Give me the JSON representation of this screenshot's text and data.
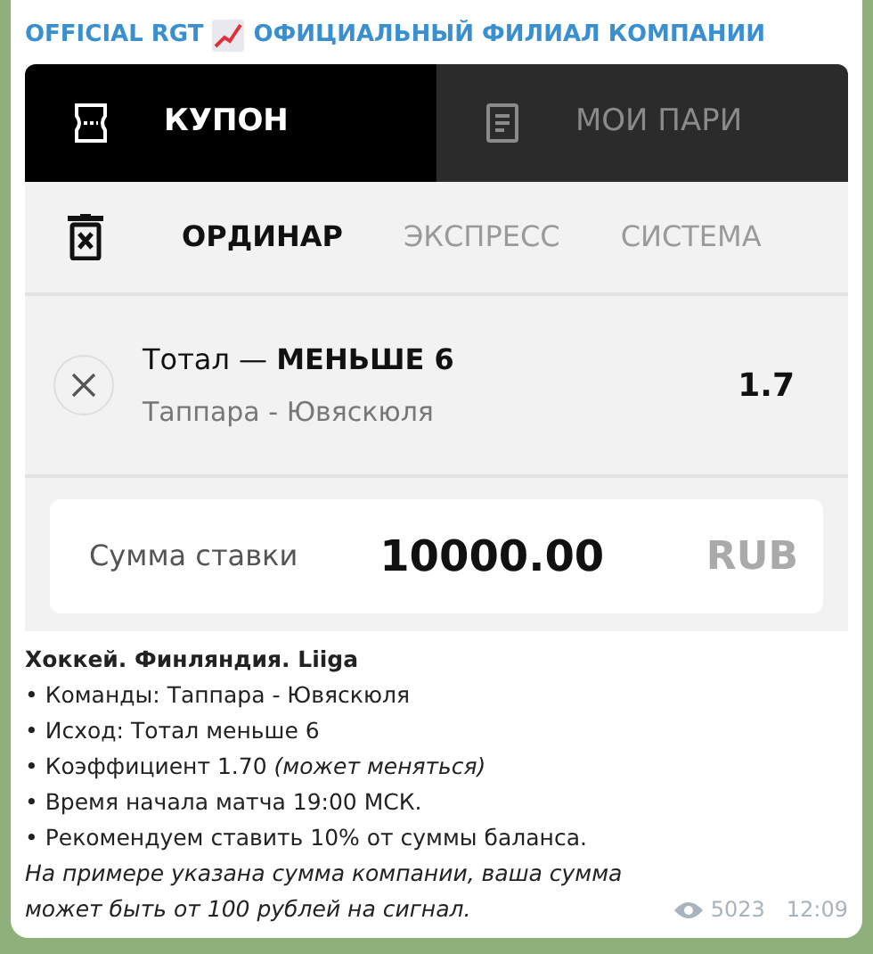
{
  "channel": {
    "name_left": "OFFICIAL RGT",
    "name_right": "ОФИЦИАЛЬНЫЙ ФИЛИАЛ КОМПАНИИ"
  },
  "coupon": {
    "tabs": [
      {
        "label": "КУПОН",
        "selected": true,
        "kind": "ticket"
      },
      {
        "label": "МОИ ПАРИ",
        "selected": false,
        "kind": "document"
      }
    ],
    "bet_types": [
      {
        "label": "ОРДИНАР",
        "selected": true
      },
      {
        "label": "ЭКСПРЕСС",
        "selected": false
      },
      {
        "label": "СИСТЕМА",
        "selected": false
      }
    ],
    "bet": {
      "market": "Тотал — **МЕНЬШЕ 6**",
      "match": "Таппара - Ювяскюля",
      "odds": "1.7"
    },
    "stake": {
      "label": "Сумма ставки",
      "value": "10000.00",
      "currency": "RUB"
    }
  },
  "message": [
    {
      "kind": "title",
      "text": "Хоккей. Финляндия. Liiga"
    },
    {
      "kind": "bullet",
      "text": "• Команды: Таппара - Ювяскюля"
    },
    {
      "kind": "bullet",
      "text": "• Исход: Тотал меньше 6"
    },
    {
      "kind": "bullet",
      "text": "• Коэффициент 1.70 *(может меняться)*"
    },
    {
      "kind": "bullet",
      "text": "• Время начала матча 19:00 МСК."
    },
    {
      "kind": "bullet",
      "text": "• Рекомендуем ставить 10% от суммы баланса."
    },
    {
      "kind": "note",
      "text": "На примере указана сумма компании, ваша сумма может быть от 100 рублей на сигнал."
    }
  ],
  "meta": {
    "views": "5023",
    "time": "12:09"
  }
}
